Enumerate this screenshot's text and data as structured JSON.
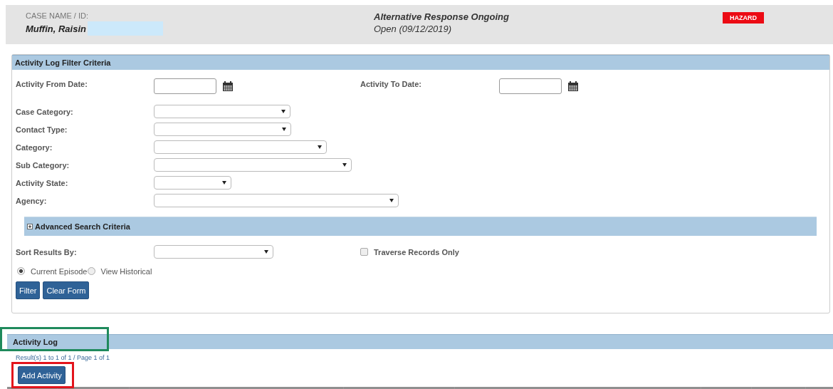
{
  "case_header": {
    "label": "CASE NAME / ID:",
    "name": "Muffin, Raisin",
    "program": "Alternative Response Ongoing",
    "status": "Open (09/12/2019)",
    "badge": "HAZARD"
  },
  "filter_panel": {
    "title": "Activity Log Filter Criteria",
    "date_fields": [
      {
        "label": "Activity From Date:"
      },
      {
        "label": "Activity To Date:"
      }
    ],
    "selects": [
      {
        "label": "Case Category:"
      },
      {
        "label": "Contact Type:"
      },
      {
        "label": "Category:"
      },
      {
        "label": "Sub Category:"
      },
      {
        "label": "Activity State:"
      },
      {
        "label": "Agency:"
      }
    ],
    "advanced": {
      "title": "Advanced Search Criteria",
      "expanded": false
    },
    "sort": {
      "label": "Sort Results By:"
    },
    "traverse": {
      "label": "Traverse Records Only",
      "checked": false
    },
    "episode_options": [
      {
        "label": "Current Episode",
        "selected": true
      },
      {
        "label": "View Historical",
        "selected": false
      }
    ],
    "buttons": [
      "Filter",
      "Clear Form"
    ]
  },
  "activity_log": {
    "title": "Activity Log",
    "results": "Result(s) 1 to 1 of 1 / Page 1 of 1",
    "add_button": "Add Activity"
  }
}
